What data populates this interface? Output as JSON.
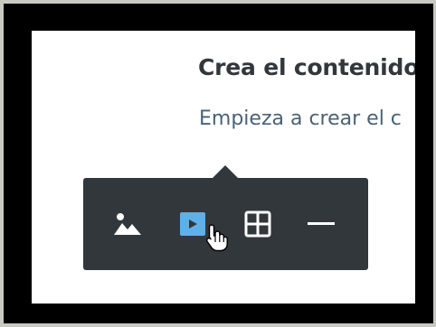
{
  "editor": {
    "heading": "Crea el contenido",
    "subtext": "Empieza a crear el c"
  },
  "block_popover": {
    "buttons": [
      {
        "name": "image",
        "icon": "image-icon",
        "active": false
      },
      {
        "name": "video",
        "icon": "video-play-icon",
        "active": true
      },
      {
        "name": "table",
        "icon": "table-grid-icon",
        "active": false
      },
      {
        "name": "separator",
        "icon": "horizontal-rule-icon",
        "active": false
      }
    ],
    "active_color": "#5fb0e8",
    "background_color": "#32373c"
  },
  "colors": {
    "heading": "#32373c",
    "subtext": "#4a6275",
    "canvas": "#ffffff",
    "frame": "#000000"
  }
}
